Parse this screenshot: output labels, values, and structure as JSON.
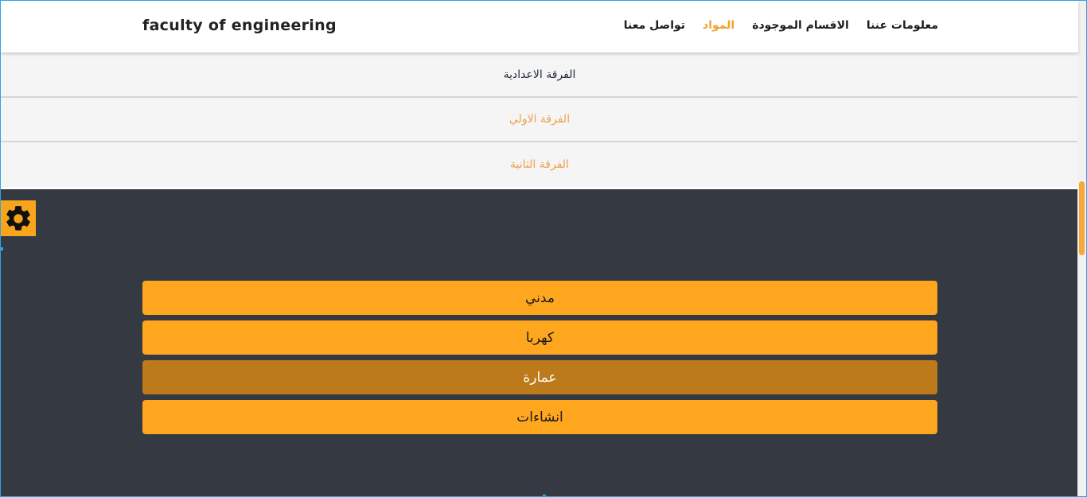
{
  "navbar": {
    "brand": "faculty of engineering",
    "links": [
      {
        "label": "تواصل معنا",
        "active": false
      },
      {
        "label": "المواد",
        "active": true
      },
      {
        "label": "الاقسام الموجودة",
        "active": false
      },
      {
        "label": "معلومات عننا",
        "active": false
      }
    ]
  },
  "years": [
    {
      "label": "الفرقة الاعدادية"
    },
    {
      "label": "الفرقة الاولي"
    },
    {
      "label": "الفرقة الثانية"
    }
  ],
  "settings": {
    "icon": "gear-icon"
  },
  "departments": [
    {
      "label": "مدني"
    },
    {
      "label": "كهربا"
    },
    {
      "label": "عمارة"
    },
    {
      "label": "انشاءات"
    }
  ],
  "colors": {
    "accent": "#fea61d",
    "accent_selected": "#bd7a1b",
    "active_link": "#f2a22a",
    "dark_bg": "#353942"
  }
}
